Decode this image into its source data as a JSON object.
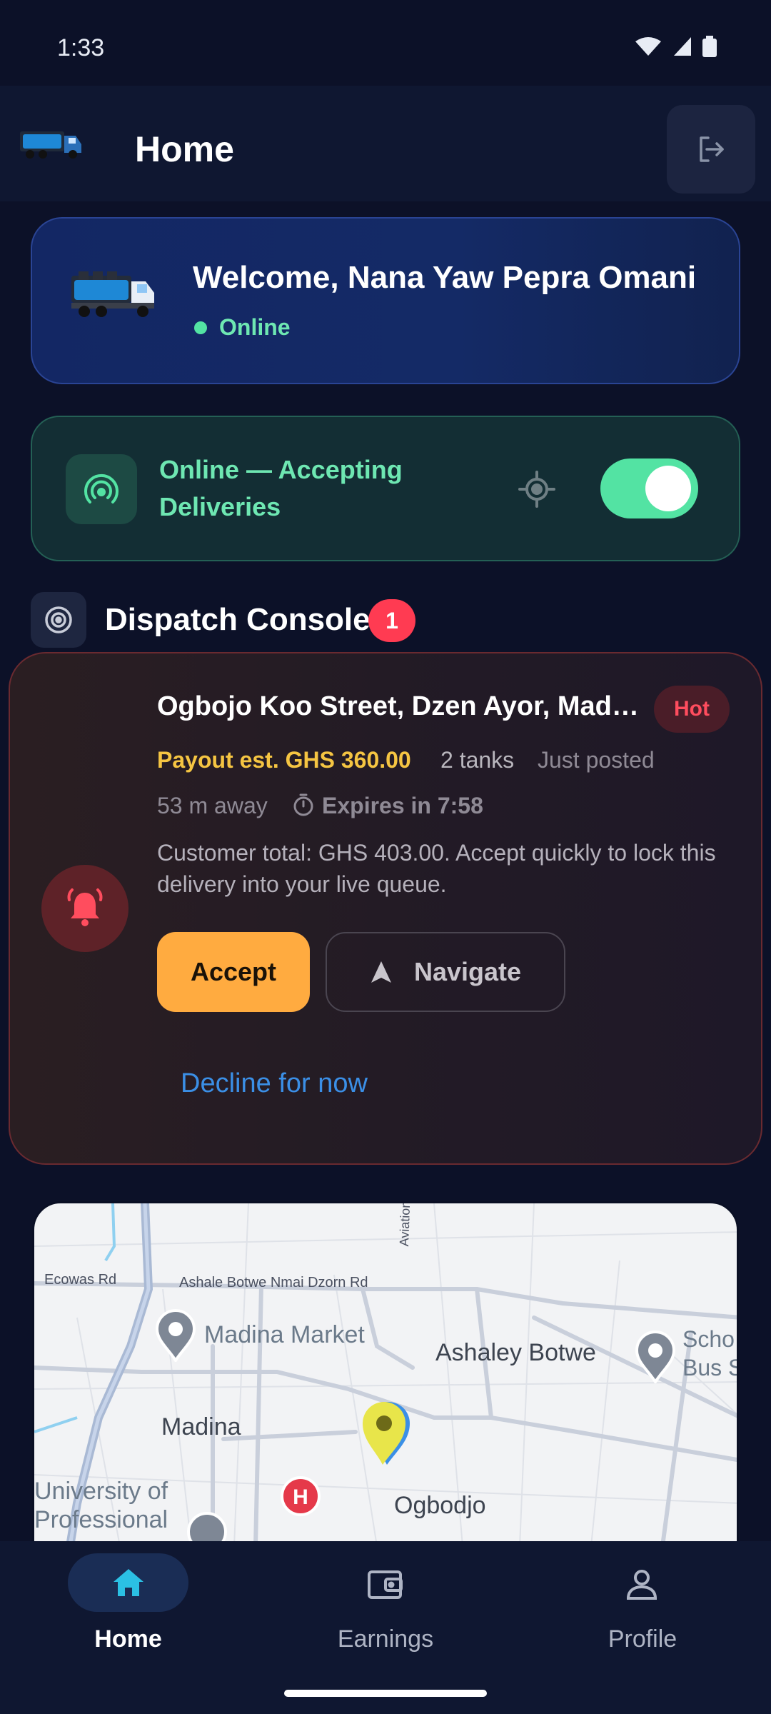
{
  "status_bar": {
    "time": "1:33"
  },
  "header": {
    "title": "Home",
    "logout_icon": "logout-icon"
  },
  "welcome": {
    "greeting": "Welcome, Nana Yaw Pepra Omani",
    "status": "Online"
  },
  "online_toggle": {
    "label": "Online — Accepting Deliveries",
    "enabled": true
  },
  "console": {
    "title": "Dispatch Console",
    "badge_count": "1"
  },
  "dispatch": {
    "address": "Ogbojo Koo Street, Dzen Ayor, Madina",
    "priority": "Hot",
    "payout": "Payout est. GHS 360.00",
    "tanks": "2 tanks",
    "posted": "Just posted",
    "distance": "53 m away",
    "expires": "Expires in 7:58",
    "description": "Customer total: GHS 403.00. Accept quickly to lock this delivery into your live queue.",
    "accept_label": "Accept",
    "navigate_label": "Navigate",
    "decline_label": "Decline for now"
  },
  "map": {
    "labels": {
      "ecowas": "Ecowas Rd",
      "ashale_botwe_road": "Ashale Botwe Nmai Dzorn Rd",
      "aviation": "Aviation Rd",
      "madina_market": "Madina Market",
      "ashaley_botwe": "Ashaley Botwe",
      "school_bus_1": "Scho",
      "school_bus_2": "Bus S",
      "madina": "Madina",
      "university_1": "University of",
      "university_2": "Professional",
      "ogbodjo": "Ogbodjo"
    }
  },
  "nav": {
    "home": "Home",
    "earnings": "Earnings",
    "profile": "Profile"
  },
  "colors": {
    "background": "#0c1128",
    "accent_green": "#53e3a3",
    "accent_orange": "#ffab40",
    "payout_yellow": "#f5c542",
    "hot_red": "#ff4d5e",
    "link_blue": "#3b8fe6"
  }
}
